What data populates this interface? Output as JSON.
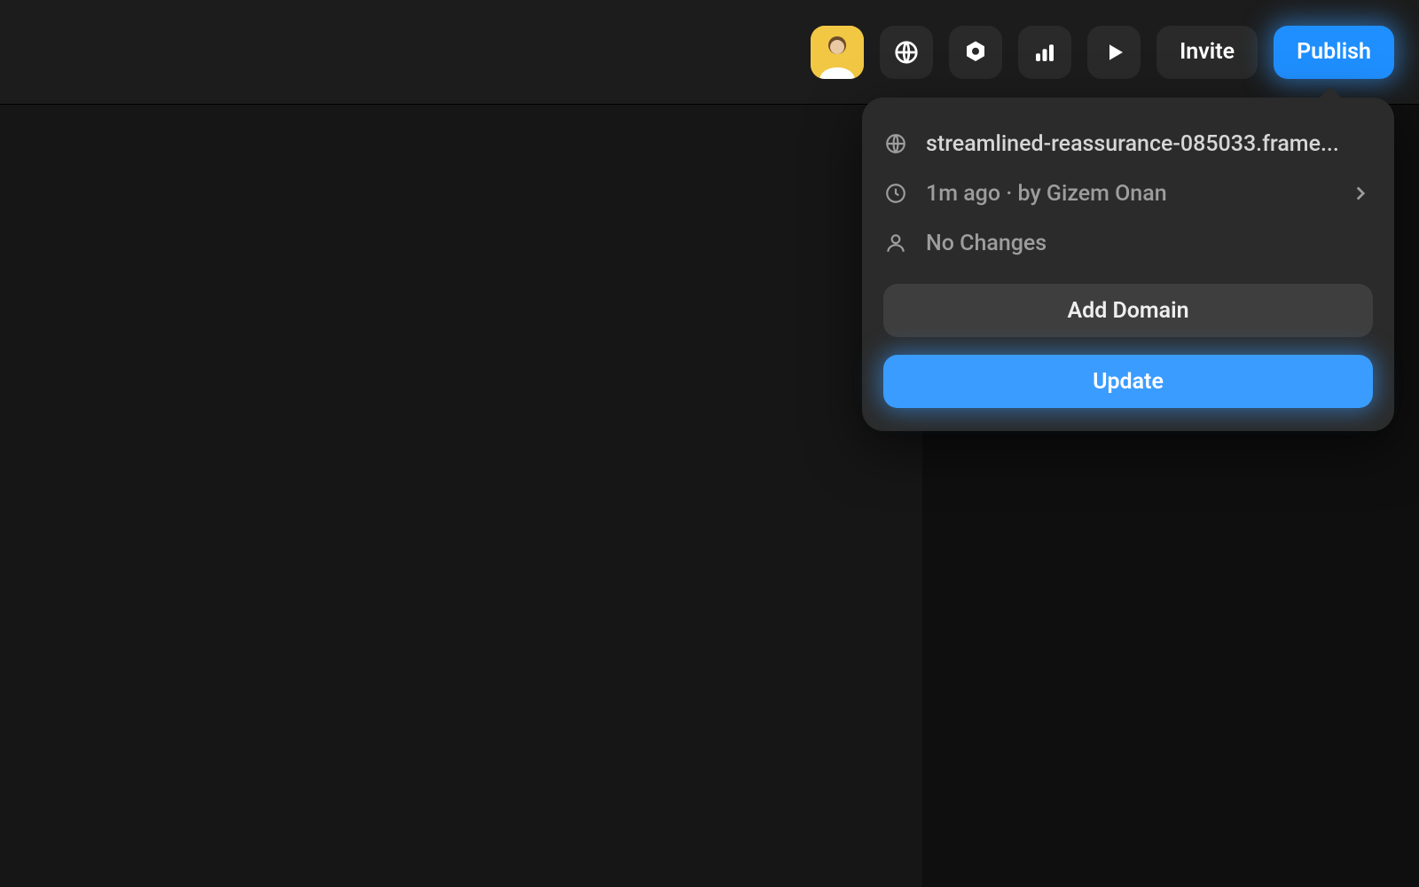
{
  "toolbar": {
    "invite_label": "Invite",
    "publish_label": "Publish"
  },
  "popover": {
    "domain": "streamlined-reassurance-085033.frame...",
    "last_published": "1m ago · by Gizem Onan",
    "changes": "No Changes",
    "add_domain_label": "Add Domain",
    "update_label": "Update"
  }
}
